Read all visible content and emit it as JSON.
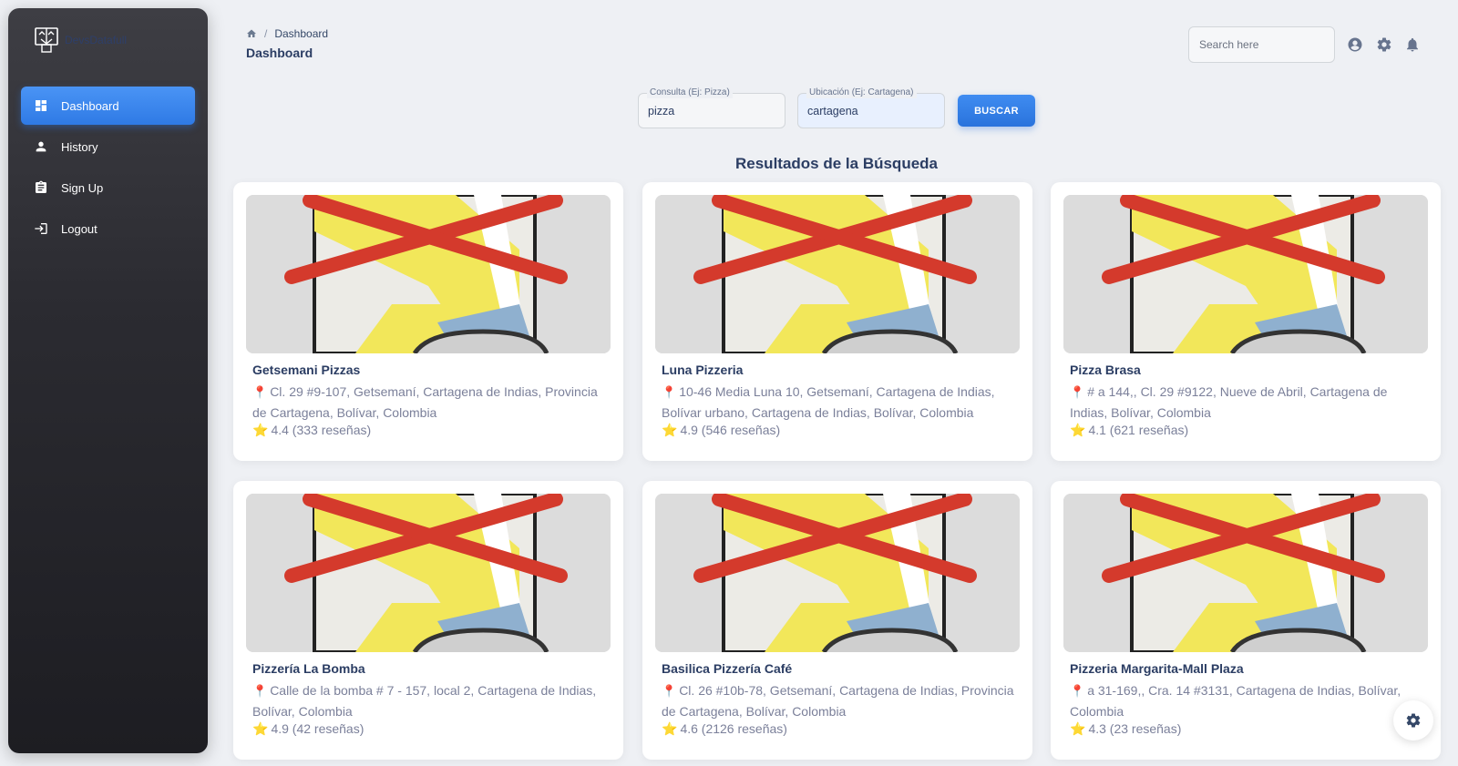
{
  "brand": {
    "name": "DevsDatafull",
    "logo_icon": "face-logo-icon"
  },
  "sidebar": {
    "items": [
      {
        "label": "Dashboard",
        "icon": "dashboard-icon",
        "active": true
      },
      {
        "label": "History",
        "icon": "person-icon",
        "active": false
      },
      {
        "label": "Sign Up",
        "icon": "clipboard-icon",
        "active": false
      },
      {
        "label": "Logout",
        "icon": "login-icon",
        "active": false
      }
    ]
  },
  "header": {
    "breadcrumb": {
      "home_icon": "home-icon",
      "separator": "/",
      "current": "Dashboard"
    },
    "title": "Dashboard",
    "search_placeholder": "Search here",
    "icons": [
      "account-icon",
      "gear-icon",
      "bell-icon"
    ]
  },
  "query": {
    "query_label": "Consulta (Ej: Pizza)",
    "query_value": "pizza",
    "location_label": "Ubicación (Ej: Cartagena)",
    "location_value": "cartagena",
    "button_label": "BUSCAR"
  },
  "results": {
    "title": "Resultados de la Búsqueda",
    "items": [
      {
        "name": "Getsemani Pizzas",
        "address": "Cl. 29 #9-107, Getsemaní, Cartagena de Indias, Provincia de Cartagena, Bolívar, Colombia",
        "rating": "4.4 (333 reseñas)"
      },
      {
        "name": "Luna Pizzeria",
        "address": "10-46 Media Luna 10, Getsemaní, Cartagena de Indias, Bolívar urbano, Cartagena de Indias, Bolívar, Colombia",
        "rating": "4.9 (546 reseñas)"
      },
      {
        "name": "Pizza Brasa",
        "address": "# a 144,, Cl. 29 #9122, Nueve de Abril, Cartagena de Indias, Bolívar, Colombia",
        "rating": "4.1 (621 reseñas)"
      },
      {
        "name": "Pizzería La Bomba",
        "address": "Calle de la bomba # 7 - 157, local 2, Cartagena de Indias, Bolívar, Colombia",
        "rating": "4.9 (42 reseñas)"
      },
      {
        "name": "Basilica Pizzería Café",
        "address": "Cl. 26 #10b-78, Getsemaní, Cartagena de Indias, Provincia de Cartagena, Bolívar, Colombia",
        "rating": "4.6 (2126 reseñas)"
      },
      {
        "name": "Pizzeria Margarita-Mall Plaza",
        "address": "a 31-169,, Cra. 14 #3131, Cartagena de Indias, Bolívar, Colombia",
        "rating": "4.3 (23 reseñas)"
      }
    ]
  },
  "fab_icon": "gear-icon",
  "colors": {
    "accent": "#2f7ae5",
    "sidebar_dark": "#1d1d22",
    "title": "#2b3d63",
    "pin": "#e2463a",
    "star": "#f5b301"
  }
}
